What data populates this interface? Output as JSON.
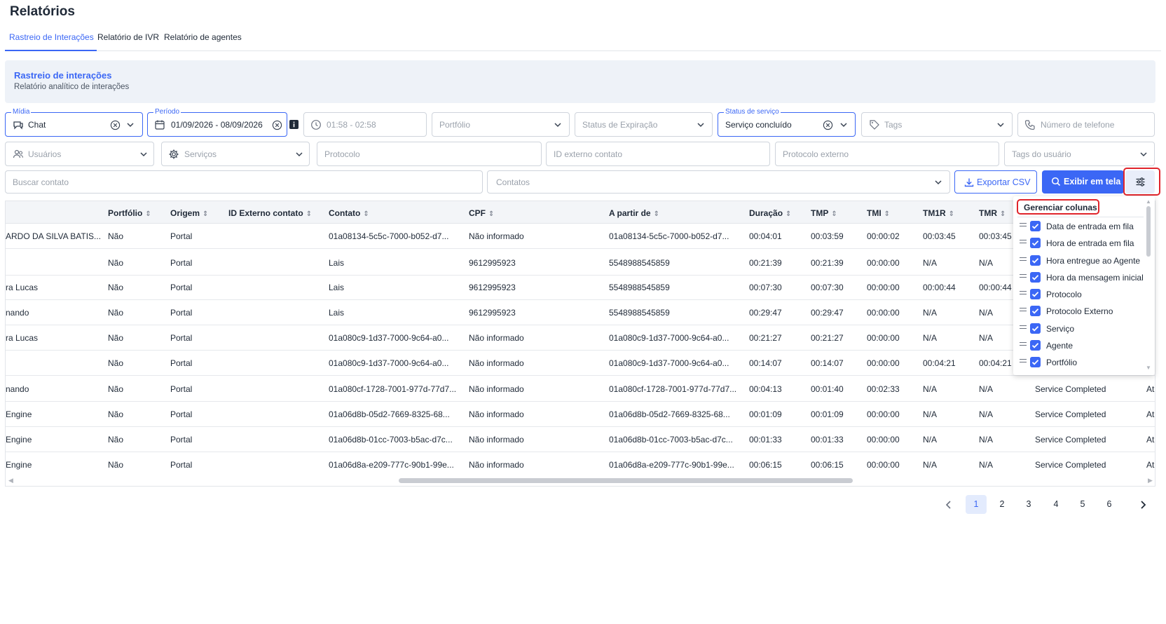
{
  "page": {
    "title": "Relatórios"
  },
  "tabs": [
    {
      "label": "Rastreio de Interações"
    },
    {
      "label": "Relatório de IVR"
    },
    {
      "label": "Relatório de agentes"
    }
  ],
  "banner": {
    "title": "Rastreio de interações",
    "subtitle": "Relatório analítico de interações"
  },
  "filters": {
    "midia": {
      "label": "Mídia",
      "value": "Chat",
      "icon": "chat-icon"
    },
    "periodo": {
      "label": "Período",
      "value": "01/09/2026 - 08/09/2026",
      "icon": "calendar-icon"
    },
    "horario": {
      "placeholder": "01:58 - 02:58",
      "icon": "clock-icon"
    },
    "portfolio": {
      "placeholder": "Portfólio"
    },
    "status_expiracao": {
      "placeholder": "Status de Expiração"
    },
    "status_servico": {
      "label": "Status de serviço",
      "value": "Serviço concluído"
    },
    "tags": {
      "placeholder": "Tags",
      "icon": "tag-icon"
    },
    "telefone": {
      "placeholder": "Número de telefone",
      "icon": "phone-icon"
    },
    "usuarios": {
      "placeholder": "Usuários",
      "icon": "users-icon"
    },
    "servicos": {
      "placeholder": "Serviços",
      "icon": "gear-icon"
    },
    "protocolo": {
      "placeholder": "Protocolo"
    },
    "id_externo": {
      "placeholder": "ID externo contato"
    },
    "protocolo_externo": {
      "placeholder": "Protocolo externo"
    },
    "tags_usuario": {
      "placeholder": "Tags do usuário"
    },
    "buscar_contato": {
      "placeholder": "Buscar contato"
    },
    "contatos": {
      "placeholder": "Contatos"
    }
  },
  "actions": {
    "export_label": "Exportar CSV",
    "show_label": "Exibir em tela"
  },
  "table": {
    "columns": [
      "Portfólio",
      "Origem",
      "ID Externo contato",
      "Contato",
      "CPF",
      "A partir de",
      "Duração",
      "TMP",
      "TMI",
      "TM1R",
      "TMR"
    ],
    "rows": [
      {
        "agent": "ARDO DA SILVA BATIS...",
        "portfolio": "Não",
        "origem": "Portal",
        "id_externo": "",
        "contato": "01a08134-5c5c-7000-b052-d7...",
        "cpf": "Não informado",
        "a_partir": "01a08134-5c5c-7000-b052-d7...",
        "duracao": "00:04:01",
        "tmp": "00:03:59",
        "tmi": "00:00:02",
        "tm1r": "00:03:45",
        "tmr": "00:03:45",
        "status": "",
        "extra": ""
      },
      {
        "agent": "",
        "portfolio": "Não",
        "origem": "Portal",
        "id_externo": "",
        "contato": "Lais",
        "cpf": "9612995923",
        "a_partir": "5548988545859",
        "duracao": "00:21:39",
        "tmp": "00:21:39",
        "tmi": "00:00:00",
        "tm1r": "N/A",
        "tmr": "N/A",
        "status": "",
        "extra": ""
      },
      {
        "agent": "ra Lucas",
        "portfolio": "Não",
        "origem": "Portal",
        "id_externo": "",
        "contato": "Lais",
        "cpf": "9612995923",
        "a_partir": "5548988545859",
        "duracao": "00:07:30",
        "tmp": "00:07:30",
        "tmi": "00:00:00",
        "tm1r": "00:00:44",
        "tmr": "00:00:44",
        "status": "",
        "extra": ""
      },
      {
        "agent": "nando",
        "portfolio": "Não",
        "origem": "Portal",
        "id_externo": "",
        "contato": "Lais",
        "cpf": "9612995923",
        "a_partir": "5548988545859",
        "duracao": "00:29:47",
        "tmp": "00:29:47",
        "tmi": "00:00:00",
        "tm1r": "N/A",
        "tmr": "N/A",
        "status": "",
        "extra": ""
      },
      {
        "agent": "ra Lucas",
        "portfolio": "Não",
        "origem": "Portal",
        "id_externo": "",
        "contato": "01a080c9-1d37-7000-9c64-a0...",
        "cpf": "Não informado",
        "a_partir": "01a080c9-1d37-7000-9c64-a0...",
        "duracao": "00:21:27",
        "tmp": "00:21:27",
        "tmi": "00:00:00",
        "tm1r": "N/A",
        "tmr": "N/A",
        "status": "",
        "extra": ""
      },
      {
        "agent": "",
        "portfolio": "Não",
        "origem": "Portal",
        "id_externo": "",
        "contato": "01a080c9-1d37-7000-9c64-a0...",
        "cpf": "Não informado",
        "a_partir": "01a080c9-1d37-7000-9c64-a0...",
        "duracao": "00:14:07",
        "tmp": "00:14:07",
        "tmi": "00:00:00",
        "tm1r": "00:04:21",
        "tmr": "00:04:21",
        "status": "",
        "extra": ""
      },
      {
        "agent": "nando",
        "portfolio": "Não",
        "origem": "Portal",
        "id_externo": "",
        "contato": "01a080cf-1728-7001-977d-77d7...",
        "cpf": "Não informado",
        "a_partir": "01a080cf-1728-7001-977d-77d7...",
        "duracao": "00:04:13",
        "tmp": "00:01:40",
        "tmi": "00:02:33",
        "tm1r": "N/A",
        "tmr": "N/A",
        "status": "Service Completed",
        "extra": "At"
      },
      {
        "agent": "Engine",
        "portfolio": "Não",
        "origem": "Portal",
        "id_externo": "",
        "contato": "01a06d8b-05d2-7669-8325-68...",
        "cpf": "Não informado",
        "a_partir": "01a06d8b-05d2-7669-8325-68...",
        "duracao": "00:01:09",
        "tmp": "00:01:09",
        "tmi": "00:00:00",
        "tm1r": "N/A",
        "tmr": "N/A",
        "status": "Service Completed",
        "extra": "At"
      },
      {
        "agent": "Engine",
        "portfolio": "Não",
        "origem": "Portal",
        "id_externo": "",
        "contato": "01a06d8b-01cc-7003-b5ac-d7c...",
        "cpf": "Não informado",
        "a_partir": "01a06d8b-01cc-7003-b5ac-d7c...",
        "duracao": "00:01:33",
        "tmp": "00:01:33",
        "tmi": "00:00:00",
        "tm1r": "N/A",
        "tmr": "N/A",
        "status": "Service Completed",
        "extra": "At"
      },
      {
        "agent": "Engine",
        "portfolio": "Não",
        "origem": "Portal",
        "id_externo": "",
        "contato": "01a06d8a-e209-777c-90b1-99e...",
        "cpf": "Não informado",
        "a_partir": "01a06d8a-e209-777c-90b1-99e...",
        "duracao": "00:06:15",
        "tmp": "00:06:15",
        "tmi": "00:00:00",
        "tm1r": "N/A",
        "tmr": "N/A",
        "status": "Service Completed",
        "extra": "At"
      }
    ]
  },
  "column_manager": {
    "title": "Gerenciar colunas",
    "items": [
      {
        "label": "Data de entrada em fila",
        "checked": true
      },
      {
        "label": "Hora de entrada em fila",
        "checked": true
      },
      {
        "label": "Hora entregue ao Agente",
        "checked": true
      },
      {
        "label": "Hora da mensagem inicial",
        "checked": true
      },
      {
        "label": "Protocolo",
        "checked": true
      },
      {
        "label": "Protocolo Externo",
        "checked": true
      },
      {
        "label": "Serviço",
        "checked": true
      },
      {
        "label": "Agente",
        "checked": true
      },
      {
        "label": "Portfólio",
        "checked": true
      }
    ]
  },
  "pagination": {
    "pages": [
      "1",
      "2",
      "3",
      "4",
      "5",
      "6"
    ],
    "current": "1"
  },
  "colors": {
    "accent": "#3b67f5",
    "highlight": "#e0242b",
    "banner_bg": "#eef2f8"
  }
}
